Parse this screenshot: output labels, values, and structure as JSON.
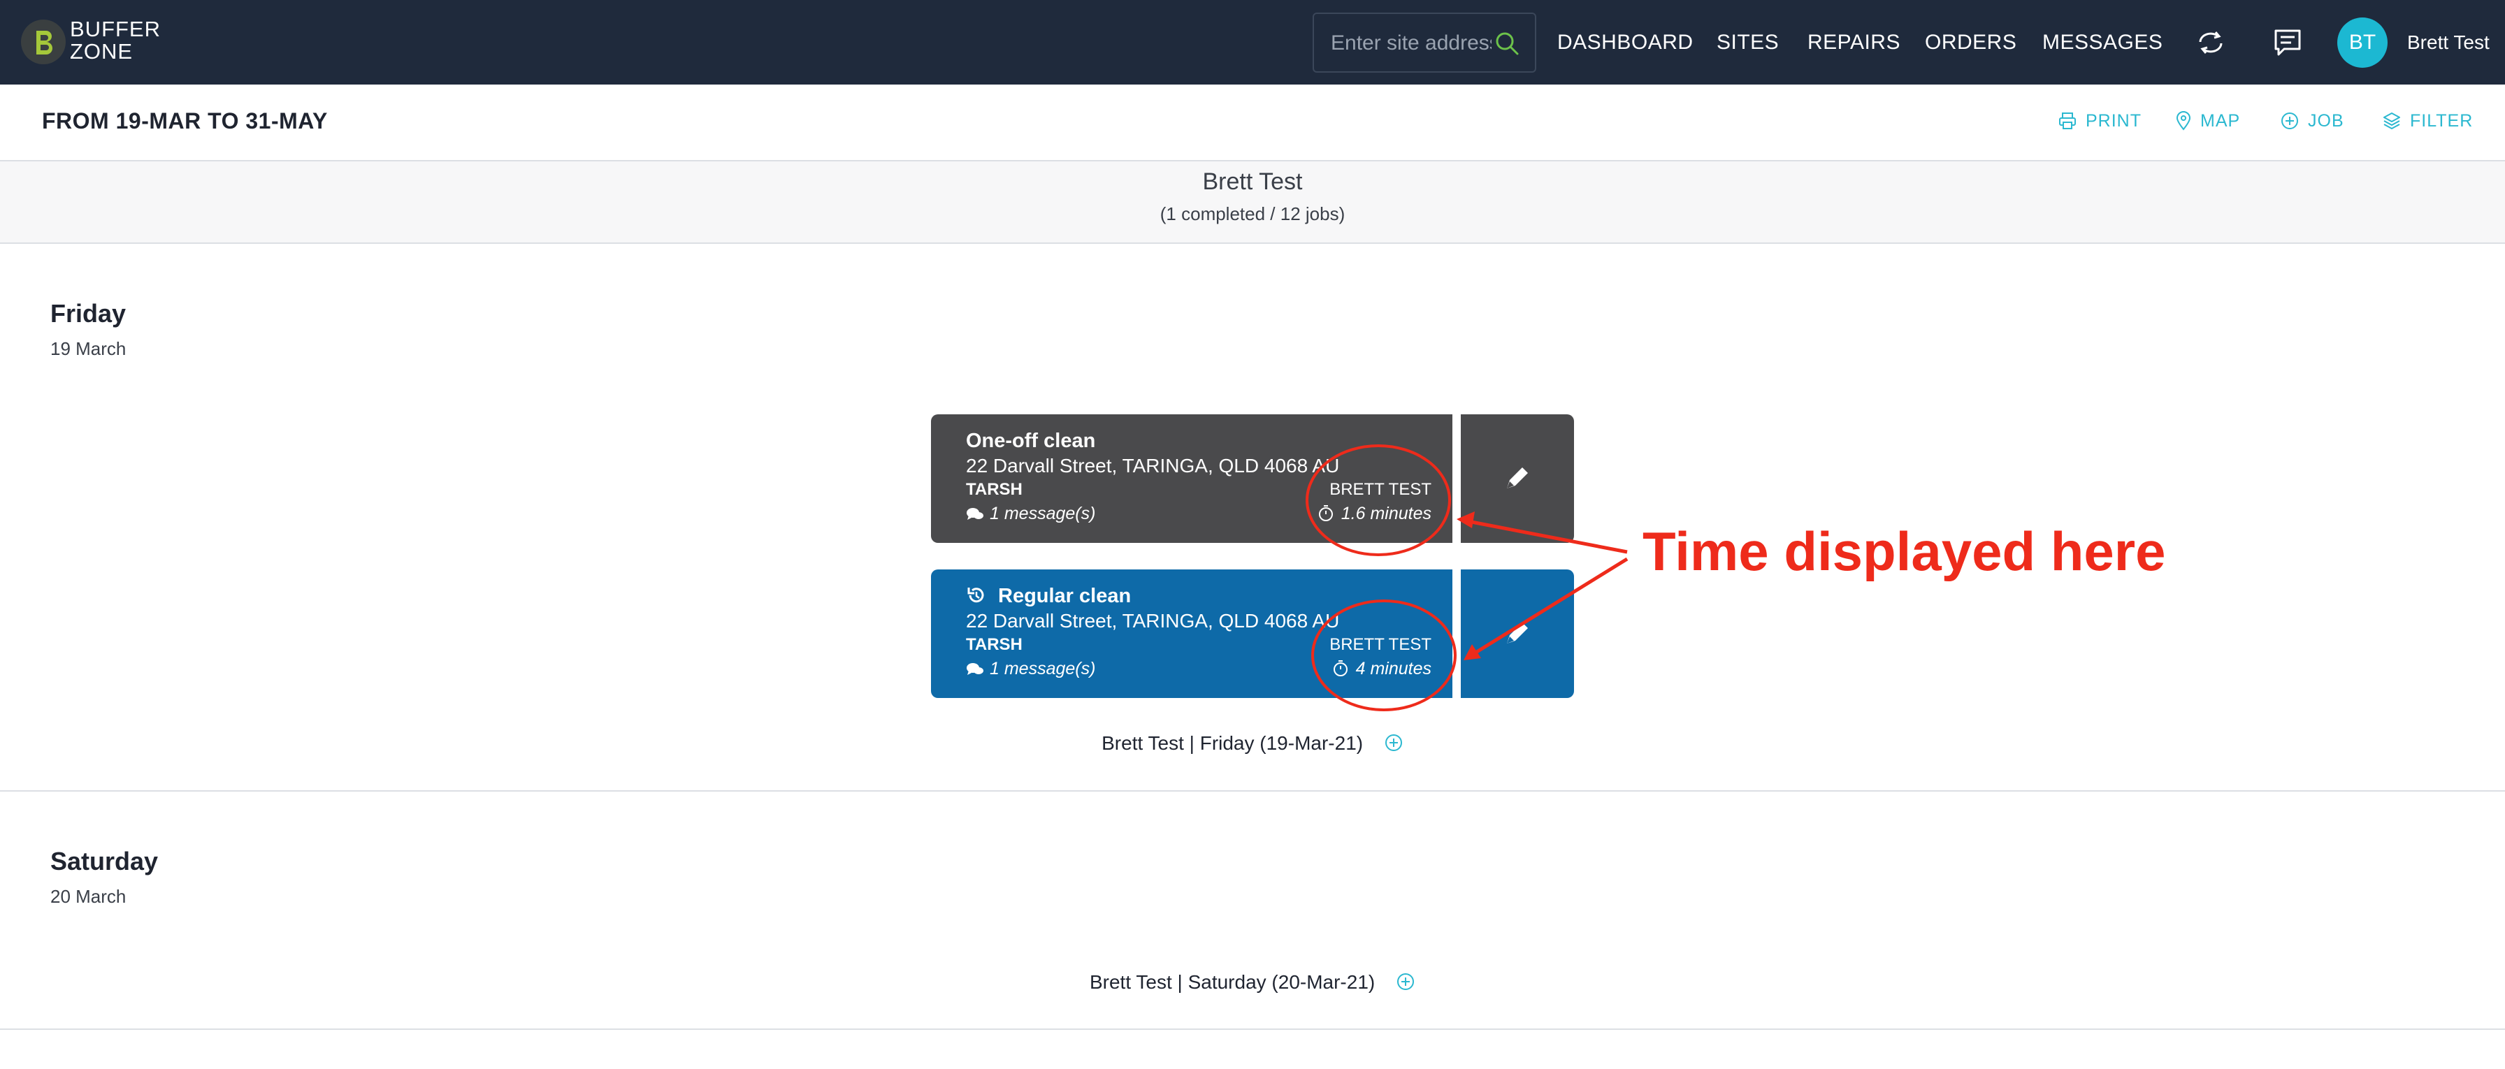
{
  "nav": {
    "logo_line1": "BUFFER",
    "logo_line2": "ZONE",
    "search_placeholder": "Enter site address",
    "items": [
      "DASHBOARD",
      "SITES",
      "REPAIRS",
      "ORDERS",
      "MESSAGES"
    ],
    "avatar_initials": "BT",
    "username": "Brett Test",
    "logo_color": "#a5c83a",
    "search_icon_color": "#6cc24a"
  },
  "subheader": {
    "title": "FROM 19-MAR TO 31-MAY",
    "actions": [
      "PRINT",
      "MAP",
      "JOB",
      "FILTER"
    ],
    "accent": "#2bb8d0"
  },
  "technician": {
    "name": "Brett Test",
    "summary": "(1 completed / 12 jobs)"
  },
  "days": [
    {
      "day": "Friday",
      "date": "19 March",
      "jobs": [
        {
          "title": "One-off clean",
          "address": "22 Darvall Street, TARINGA, QLD 4068 AU",
          "tech": "TARSH",
          "messages": "1 message(s)",
          "assignee": "BRETT TEST",
          "duration": "1.6 minutes",
          "color": "#4a4a4c",
          "recurring": false
        },
        {
          "title": "Regular clean",
          "address": "22 Darvall Street, TARINGA, QLD 4068 AU",
          "tech": "TARSH",
          "messages": "1 message(s)",
          "assignee": "BRETT TEST",
          "duration": "4 minutes",
          "color": "#0e6aa8",
          "recurring": true
        }
      ],
      "add_label": "Brett Test | Friday (19-Mar-21)"
    },
    {
      "day": "Saturday",
      "date": "20 March",
      "jobs": [],
      "add_label": "Brett Test | Saturday (20-Mar-21)"
    }
  ],
  "annotation": {
    "text": "Time displayed here",
    "color": "#ee2b1b"
  }
}
